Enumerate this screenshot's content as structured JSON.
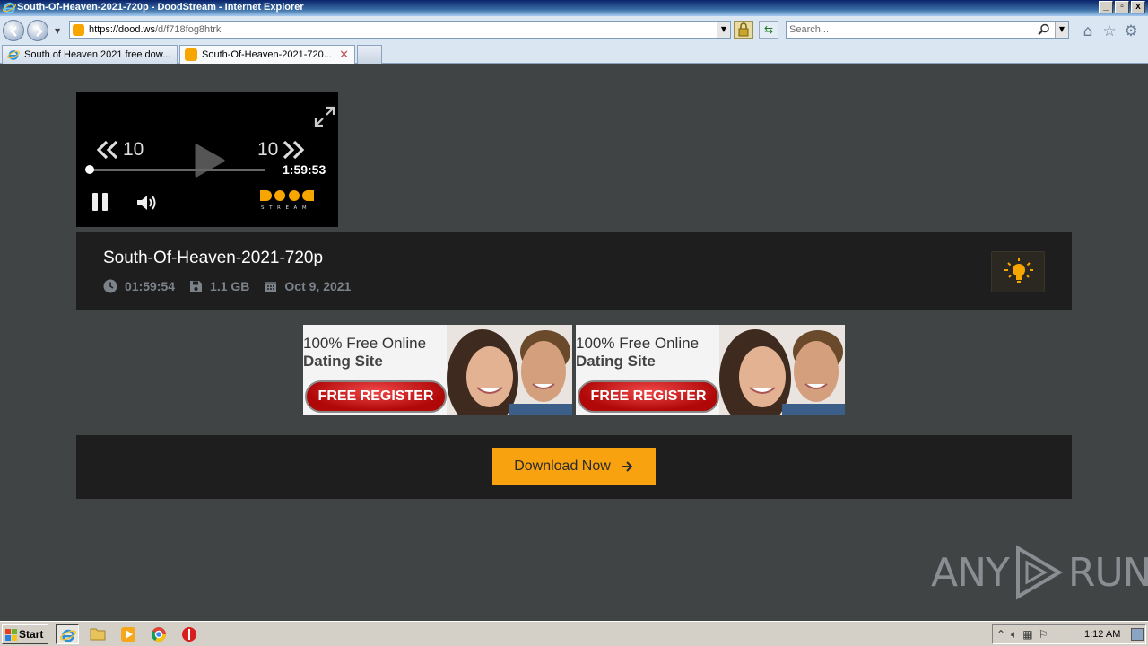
{
  "window": {
    "title": "South-Of-Heaven-2021-720p - DoodStream - Internet Explorer",
    "controls": [
      "_",
      "▫",
      "x"
    ]
  },
  "address_bar": {
    "url_host": "https://dood.ws",
    "url_path": "/d/f718fog8htrk",
    "search_placeholder": "Search..."
  },
  "tabs": [
    {
      "label": "South of Heaven 2021 free dow...",
      "active": false
    },
    {
      "label": "South-Of-Heaven-2021-720...",
      "active": true
    }
  ],
  "player": {
    "rewind_label": "10",
    "forward_label": "10",
    "remaining_time": "1:59:53",
    "progress": 0.01,
    "logo_text": "STREAM"
  },
  "video": {
    "title": "South-Of-Heaven-2021-720p",
    "duration": "01:59:54",
    "size": "1.1 GB",
    "date": "Oct 9, 2021"
  },
  "ads": [
    {
      "line1": "100% Free Online",
      "line2": "Dating Site",
      "button": "FREE REGISTER"
    },
    {
      "line1": "100% Free Online",
      "line2": "Dating Site",
      "button": "FREE REGISTER"
    }
  ],
  "download": {
    "label": "Download Now"
  },
  "watermark": {
    "left": "ANY",
    "right": "RUN"
  },
  "taskbar": {
    "start_label": "Start",
    "clock": "1:12 AM"
  },
  "colors": {
    "page_bg": "#404444",
    "panel_bg": "#1e1e1e",
    "accent": "#f9a20f"
  }
}
